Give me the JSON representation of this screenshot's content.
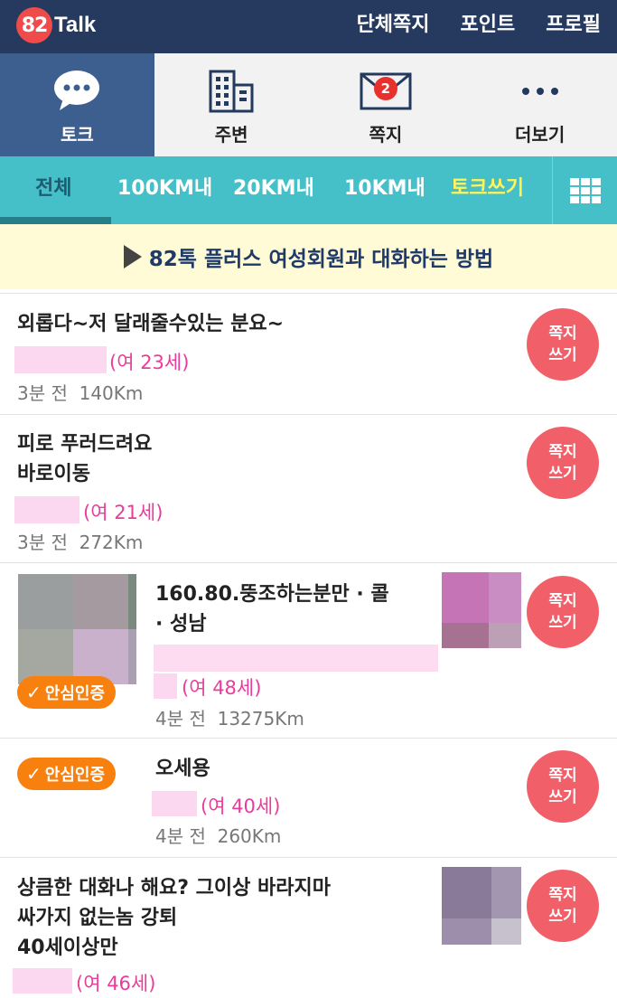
{
  "app": {
    "logo_number": "82",
    "logo_name": "Talk"
  },
  "top_links": [
    "단체쪽지",
    "포인트",
    "프로필"
  ],
  "main_tabs": [
    {
      "label": "토크",
      "icon": "chat-bubble-icon",
      "active": true
    },
    {
      "label": "주변",
      "icon": "building-icon",
      "active": false
    },
    {
      "label": "쪽지",
      "icon": "envelope-icon",
      "active": false,
      "badge": "2"
    },
    {
      "label": "더보기",
      "icon": "more-dots-icon",
      "active": false
    }
  ],
  "filters": {
    "all": "전체",
    "km100": "100KM내",
    "km20": "20KM내",
    "km10": "10KM내",
    "write": "토크쓰기"
  },
  "banner": {
    "text": "82톡 플러스 여성회원과 대화하는 방법"
  },
  "note_button": {
    "line1": "쪽지",
    "line2": "쓰기"
  },
  "certified_label": "안심인증",
  "posts": [
    {
      "title_lines": [
        "외롭다~저 달래줄수있는 분요~"
      ],
      "age": "(여 23세)",
      "time": "3분 전",
      "distance": "140Km"
    },
    {
      "title_lines": [
        "피로 푸러드려요",
        "바로이동"
      ],
      "age": "(여 21세)",
      "time": "3분 전",
      "distance": "272Km"
    },
    {
      "title_lines": [
        "160.80.뚱조하는분만 · 콜",
        "· 성남"
      ],
      "age": "(여 48세)",
      "time": "4분 전",
      "distance": "13275Km",
      "certified": true
    },
    {
      "title_lines": [
        "오세용"
      ],
      "age": "(여 40세)",
      "time": "4분 전",
      "distance": "260Km",
      "certified": true
    },
    {
      "title_lines": [
        "상큼한 대화나 해요? 그이상 바라지마",
        "싸가지 없는놈 강퇴",
        "40세이상만"
      ],
      "age": "(여 46세)"
    }
  ],
  "colors": {
    "topbar": "#253a5e",
    "active_tab": "#3d5f90",
    "filter_bar": "#46c0c8",
    "write_link": "#fff45a",
    "banner_bg": "#fffbd6",
    "note_button": "#f15f69",
    "age_text": "#e93c9b",
    "certified": "#f7800f"
  }
}
